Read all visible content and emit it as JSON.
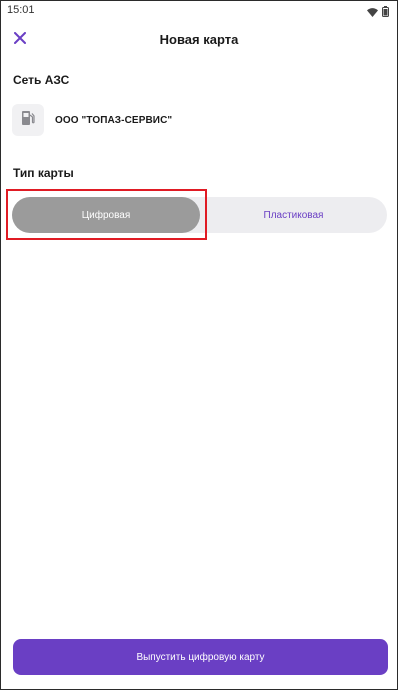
{
  "status_bar": {
    "time": "15:01",
    "icons": [
      "wifi-icon",
      "battery-icon"
    ]
  },
  "header": {
    "title": "Новая карта",
    "close_icon": "close-icon"
  },
  "station_section": {
    "title": "Сеть АЗС",
    "station": {
      "name": "ООО \"ТОПАЗ-СЕРВИС\"",
      "icon": "fuel-pump-icon"
    }
  },
  "card_type_section": {
    "title": "Тип карты",
    "options": [
      {
        "label": "Цифровая",
        "selected": true
      },
      {
        "label": "Пластиковая",
        "selected": false
      }
    ]
  },
  "primary_action": {
    "label": "Выпустить цифровую карту"
  },
  "colors": {
    "accent": "#6a3fc4",
    "selected_segment": "#9b9b9b",
    "segment_track": "#ededf0",
    "highlight": "#e01b24"
  }
}
